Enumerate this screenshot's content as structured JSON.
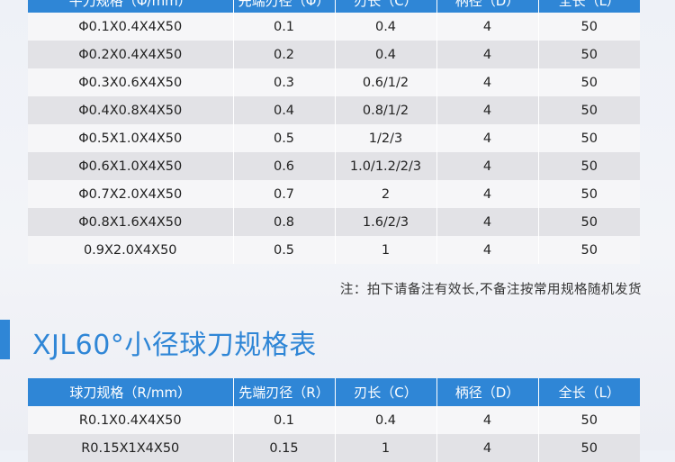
{
  "table1": {
    "headers": [
      "平刀规格（Φ/mm）",
      "先端刃径（Φ）",
      "刃长（C）",
      "柄径（D）",
      "全长（L）"
    ],
    "rows": [
      [
        "Φ0.1X0.4X4X50",
        "0.1",
        "0.4",
        "4",
        "50"
      ],
      [
        "Φ0.2X0.4X4X50",
        "0.2",
        "0.4",
        "4",
        "50"
      ],
      [
        "Φ0.3X0.6X4X50",
        "0.3",
        "0.6/1/2",
        "4",
        "50"
      ],
      [
        "Φ0.4X0.8X4X50",
        "0.4",
        "0.8/1/2",
        "4",
        "50"
      ],
      [
        "Φ0.5X1.0X4X50",
        "0.5",
        "1/2/3",
        "4",
        "50"
      ],
      [
        "Φ0.6X1.0X4X50",
        "0.6",
        "1.0/1.2/2/3",
        "4",
        "50"
      ],
      [
        "Φ0.7X2.0X4X50",
        "0.7",
        "2",
        "4",
        "50"
      ],
      [
        "Φ0.8X1.6X4X50",
        "0.8",
        "1.6/2/3",
        "4",
        "50"
      ],
      [
        "0.9X2.0X4X50",
        "0.5",
        "1",
        "4",
        "50"
      ]
    ]
  },
  "note": "注：拍下请备注有效长,不备注按常用规格随机发货",
  "section2": {
    "title": "XJL60°小径球刀规格表"
  },
  "table2": {
    "headers": [
      "球刀规格（R/mm）",
      "先端刃径（R）",
      "刃长（C）",
      "柄径（D）",
      "全长（L）"
    ],
    "rows": [
      [
        "R0.1X0.4X4X50",
        "0.1",
        "0.4",
        "4",
        "50"
      ],
      [
        "R0.15X1X4X50",
        "0.15",
        "1",
        "4",
        "50"
      ]
    ]
  },
  "colors": {
    "header_blue": "#2f86d6",
    "row_light": "#f6f6f8",
    "row_dark": "#e2e2e6"
  }
}
